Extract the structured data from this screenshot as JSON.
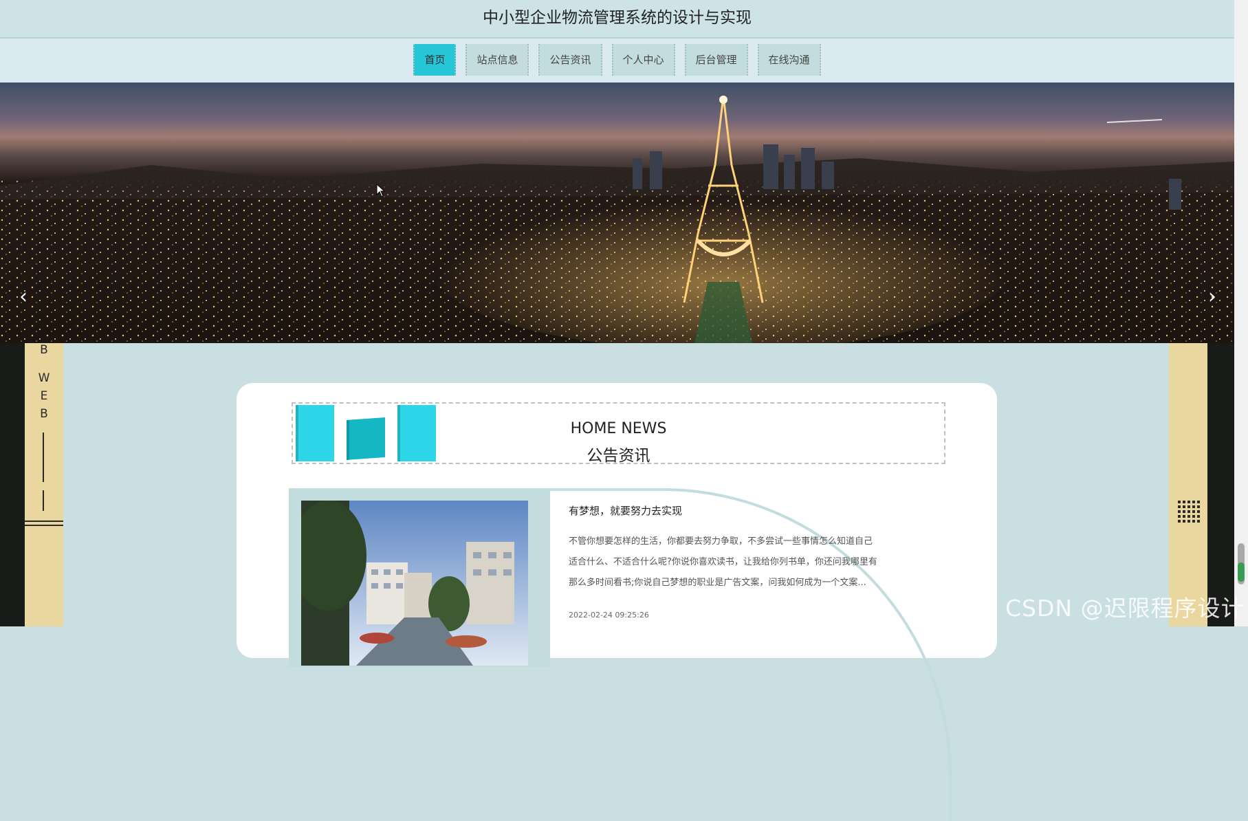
{
  "header": {
    "title": "中小型企业物流管理系统的设计与实现"
  },
  "nav": {
    "items": [
      {
        "label": "首页",
        "active": true
      },
      {
        "label": "站点信息"
      },
      {
        "label": "公告资讯"
      },
      {
        "label": "个人中心"
      },
      {
        "label": "后台管理"
      },
      {
        "label": "在线沟通"
      }
    ]
  },
  "banner": {
    "prev_icon": "chevron-left-icon",
    "next_icon": "chevron-right-icon"
  },
  "side": {
    "letters_top": "B",
    "letters_web": [
      "W",
      "E",
      "B"
    ]
  },
  "news": {
    "heading_en": "HOME NEWS",
    "heading_cn": "公告资讯",
    "item": {
      "title": "有梦想，就要努力去实现",
      "text": "不管你想要怎样的生活，你都要去努力争取，不多尝试一些事情怎么知道自己适合什么、不适合什么呢?你说你喜欢读书，让我给你列书单，你还问我哪里有那么多时间看书;你说自己梦想的职业是广告文案，问我如何成为一个文案...",
      "date": "2022-02-24 09:25:26"
    }
  },
  "watermark": "CSDN @迟限程序设计",
  "colors": {
    "accent": "#27c6d6",
    "nav_bg": "#c3dcde",
    "side_band": "#e9d79f",
    "side_dark": "#191b19"
  }
}
